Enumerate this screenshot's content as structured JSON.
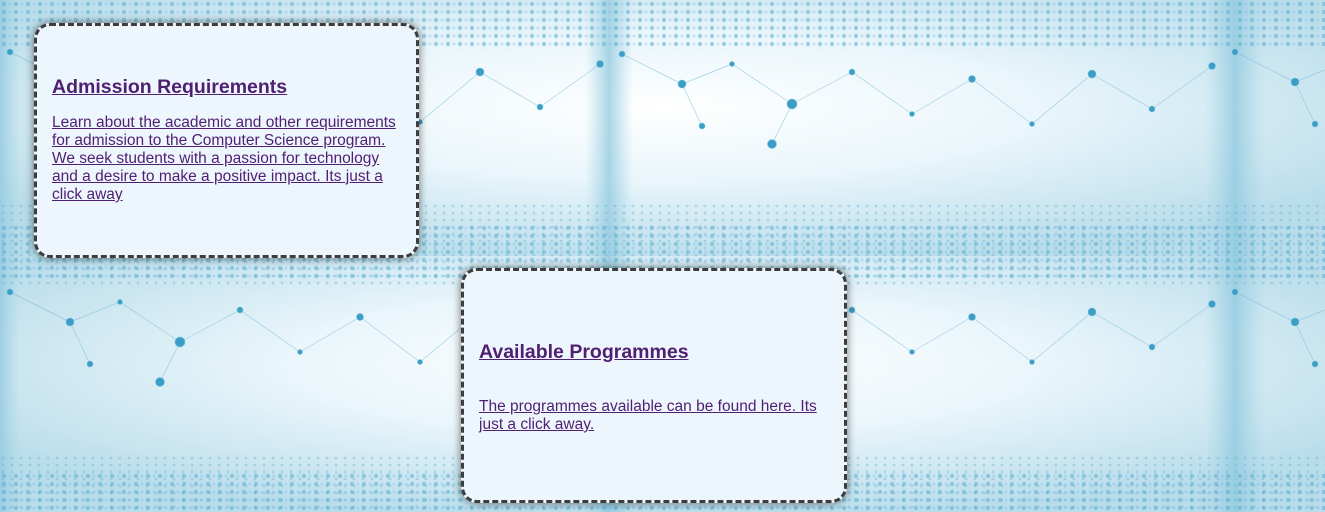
{
  "admission": {
    "title": "Admission Requirements",
    "description": "Learn about the academic and other requirements for admission to the Computer Science program. We seek students with a passion for technology and a desire to make a positive impact. Its just a click away"
  },
  "programmes": {
    "title": "Available Programmes",
    "description": "The programmes available can be found here. Its just a click away."
  },
  "colors": {
    "link": "#4f1f72",
    "card_background": "#eef6fd",
    "card_border": "#3d3d3d",
    "background_dot": "#3a9ec6"
  }
}
